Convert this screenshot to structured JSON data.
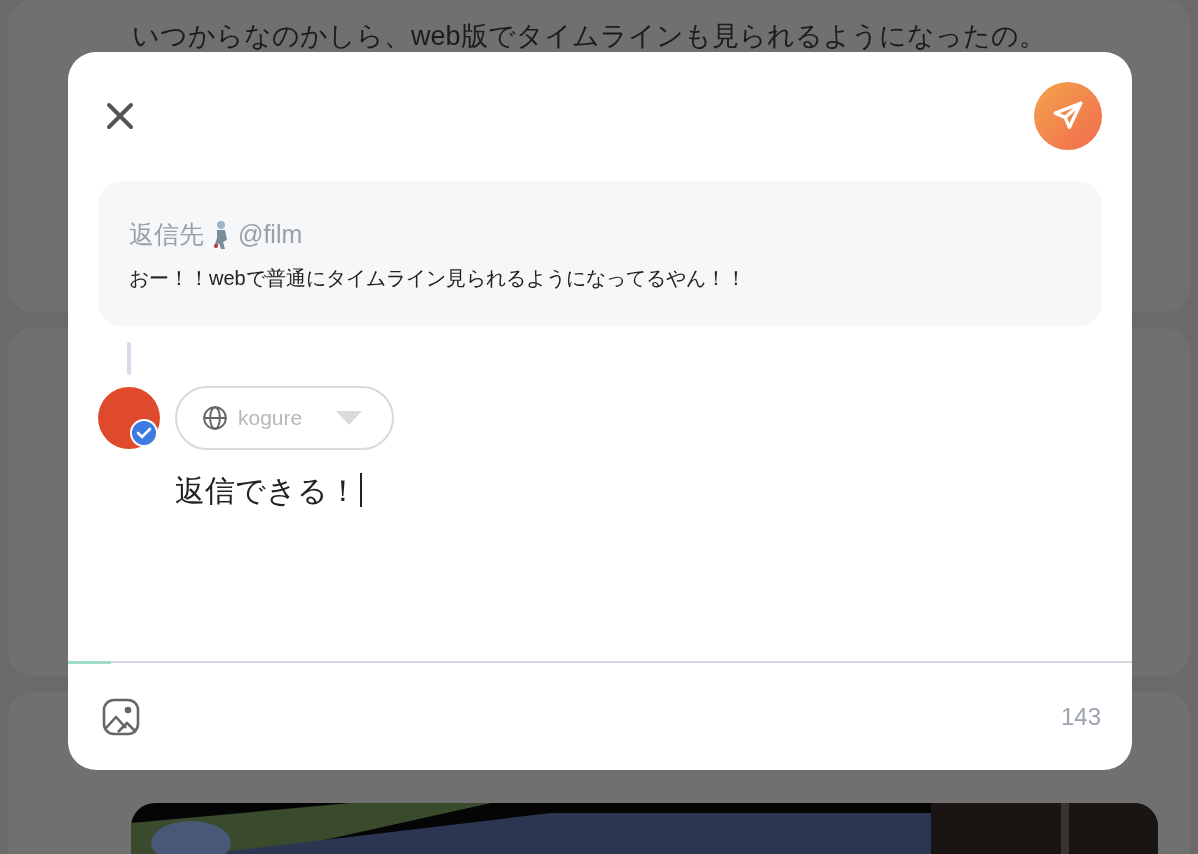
{
  "background": {
    "post_text": "いつからなのかしら、web版でタイムラインも見られるようになったの。"
  },
  "dialog": {
    "reply_to": {
      "label": "返信先",
      "handle": "@film",
      "text": "おー！！webで普通にタイムライン見られるようになってるやん！！"
    },
    "audience": {
      "value": "kogure"
    },
    "body": {
      "value": "返信できる！"
    },
    "progress": {
      "level": 0.04
    },
    "char_count": "143"
  }
}
